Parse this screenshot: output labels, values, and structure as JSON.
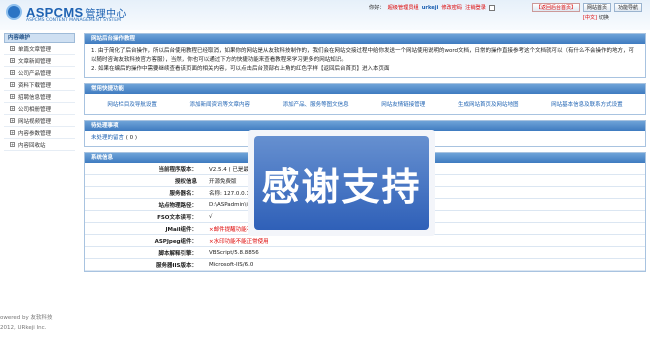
{
  "header": {
    "logo_title": "ASPCMS",
    "logo_cn": "管理中心",
    "logo_sub": "ASPCMS CONTENT MANAGEMENT SYSTEM",
    "greeting": "你好：",
    "role": "超级管理员组",
    "username": "urkeji",
    "change_pwd": "修改密码",
    "logout": "注销登录",
    "buttons": [
      "【返回后台首页】",
      "网站首页",
      "功能导航"
    ],
    "lang": "[中文]",
    "lang_switch": "切换"
  },
  "sidebar": {
    "title": "内容维护",
    "items": [
      "单篇文章管理",
      "文章新闻管理",
      "公司产品管理",
      "资料下载管理",
      "招聘信息管理",
      "公司相册管理",
      "网站视频管理",
      "内容参数管理",
      "内容回收站"
    ]
  },
  "footer": {
    "line1": "owered by 友软科技",
    "line2": "2012, URkeji Inc."
  },
  "guide": {
    "title": "网站后台操作教程",
    "p1": "1. 由于简化了后台操作，所以后台使用教程已经取消，如果你的网站是从友软科技制作的，我们会在网站交接过程中给你发送一个网站使用说明的word文档，日常的操作直接参考这个文档就可以（有什么不会操作的地方，可以随时咨询友软科技官方客服），当然，你也可以通过下方的快捷功能来查看教程来学习更多的网站知识。",
    "p2": "2. 如果在编后的操作中需要继续查看该页面的相关内容，可以点击后台顶部右上角的红色字样【返回后台首页】进入本页面"
  },
  "quick": {
    "title": "常用快捷功能",
    "links": [
      "网站栏目及导航设置",
      "添加新闻资讯等文章内容",
      "添加产品、服务等图文信息",
      "网站友情链接管理",
      "生成网站首页及网站地图",
      "网站基本信息及联系方式设置"
    ]
  },
  "todo": {
    "title": "待处理事项",
    "item_label": "未处理的留言",
    "item_count": "( 0 )"
  },
  "sysinfo": {
    "title": "系统信息",
    "rows": [
      {
        "k": "当前程序版本：",
        "v": "V2.5.4 ( 已是最新"
      },
      {
        "k": "授权信息",
        "v": "开源免费版"
      },
      {
        "k": "服务器名：",
        "v": "名称: 127.0.0.1(I"
      },
      {
        "k": "站点物理路径：",
        "v": "D:\\ASPadmin\\in"
      },
      {
        "k": "FSO文本读写：",
        "v": "√"
      },
      {
        "k": "JMail组件：",
        "v": "×邮件提醒功能不能正常使用",
        "red": true
      },
      {
        "k": "ASPJpeg组件：",
        "v": "×水印功能不能正常使用",
        "red": true
      },
      {
        "k": "脚本解释引擎：",
        "v": "VBScript/5.8.8856"
      },
      {
        "k": "服务器IIS版本：",
        "v": "Microsoft-IIS/6.0"
      }
    ]
  },
  "overlay": {
    "text": "感谢支持"
  }
}
